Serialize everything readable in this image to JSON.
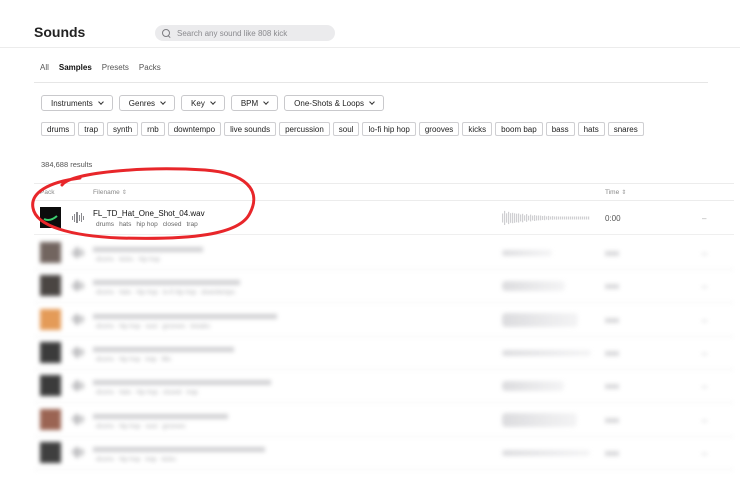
{
  "header": {
    "title": "Sounds",
    "search_placeholder": "Search any sound like 808 kick"
  },
  "tabs": [
    {
      "label": "All",
      "active": false
    },
    {
      "label": "Samples",
      "active": true
    },
    {
      "label": "Presets",
      "active": false
    },
    {
      "label": "Packs",
      "active": false
    }
  ],
  "filters": [
    "Instruments",
    "Genres",
    "Key",
    "BPM",
    "One-Shots & Loops"
  ],
  "tags": [
    "drums",
    "trap",
    "synth",
    "rnb",
    "downtempo",
    "live sounds",
    "percussion",
    "soul",
    "lo-fi hip hop",
    "grooves",
    "kicks",
    "boom bap",
    "bass",
    "hats",
    "snares"
  ],
  "results_count": "384,688 results",
  "table": {
    "col_pack": "Pack",
    "col_filename": "Filename",
    "col_time": "Time",
    "sort_glyph": "⇕"
  },
  "rows": [
    {
      "filename": "FL_TD_Hat_One_Shot_04.wav",
      "tags": [
        "drums",
        "hats",
        "hip hop",
        "closed",
        "trap"
      ],
      "time": "0:00",
      "dash": "–",
      "art_color": "#0c0c0c",
      "art_accent": "#3cd070"
    }
  ],
  "blurred_rows": [
    {
      "art_color": "#5a4b44",
      "tags": [
        "drums",
        "kicks",
        "hip hop"
      ]
    },
    {
      "art_color": "#2b2522",
      "tags": [
        "drums",
        "hats",
        "hip hop",
        "lo-fi hip hop",
        "downtempo"
      ]
    },
    {
      "art_color": "#e08a3c",
      "tags": [
        "drums",
        "hip hop",
        "soul",
        "grooves",
        "breaks"
      ]
    },
    {
      "art_color": "#1a1a1a",
      "tags": [
        "drums",
        "hip hop",
        "trap",
        "fills"
      ]
    },
    {
      "art_color": "#1a1a1a",
      "tags": [
        "drums",
        "hats",
        "hip hop",
        "closed",
        "trap"
      ]
    },
    {
      "art_color": "#8a4a36",
      "tags": [
        "drums",
        "hip hop",
        "soul",
        "grooves"
      ]
    },
    {
      "art_color": "#1e1e1e",
      "tags": [
        "drums",
        "hip hop",
        "trap",
        "kicks"
      ]
    }
  ],
  "annotation_color": "#e8262a"
}
